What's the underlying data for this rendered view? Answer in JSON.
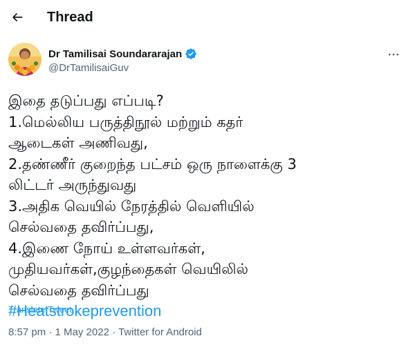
{
  "header": {
    "title": "Thread",
    "back_icon": "arrow-left-icon"
  },
  "author": {
    "name": "Dr Tamilisai Soundararajan",
    "handle": "@DrTamilisaiGuv",
    "verified": true,
    "verified_color": "#1d9bf0",
    "avatar_icon": "user-avatar"
  },
  "tweet": {
    "lines": [
      "இதை தடுப்பது எப்படி?",
      "1.மெல்லிய பருத்திநூல் மற்றும் கதர்",
      "ஆடைகள் அணிவது,",
      "2.தண்ணீர் குறைந்த பட்சம் ஒரு நாளைக்கு 3",
      "லிட்டர் அருந்துவது",
      "3.அதிக வெயில் நேரத்தில் வெளியில்",
      "செல்வதை தவிர்ப்பது,",
      "4.இணை நோய் உள்ளவர்கள்,",
      "முதியவர்கள்,குழந்தைகள் வெயிலில்",
      "செல்வதை தவிர்ப்பது"
    ],
    "hashtag": "#Heatstrokeprevention",
    "translate_label": "Translate Tweet"
  },
  "meta": {
    "time": "8:57 pm",
    "separator": " · ",
    "date": "1 May 2022",
    "source": "Twitter for Android"
  },
  "colors": {
    "link": "#1d9bf0",
    "text": "#0f1419",
    "secondary": "#536471"
  }
}
